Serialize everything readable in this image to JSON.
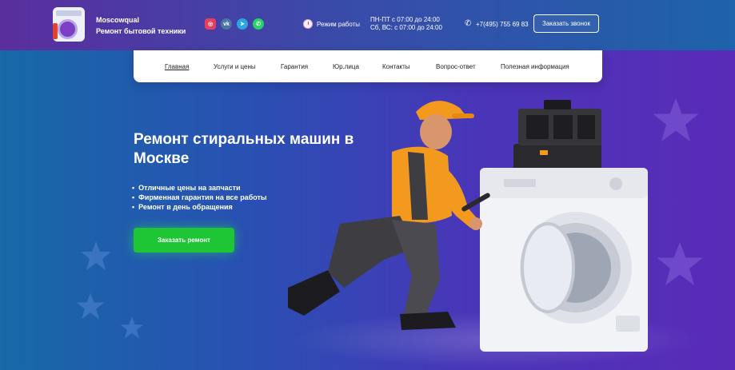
{
  "header": {
    "brand_name": "Moscowqual",
    "brand_sub": "Ремонт бытовой техники",
    "socials": [
      {
        "id": "instagram",
        "icon": "instagram-icon",
        "glyph": "◎"
      },
      {
        "id": "vk",
        "icon": "vk-icon",
        "glyph": "vk"
      },
      {
        "id": "telegram",
        "icon": "telegram-icon",
        "glyph": "➤"
      },
      {
        "id": "whatsapp",
        "icon": "whatsapp-icon",
        "glyph": "✆"
      }
    ],
    "hours_label": "Режим работы",
    "hours_weekdays": "ПН-ПТ с 07:00 до 24:00",
    "hours_weekend": "Сб, ВС: с 07:00 до 24:00",
    "phone": "+7(495) 755 69 83",
    "callback_label": "Заказать звонок"
  },
  "nav": {
    "items": [
      {
        "label": "Главная",
        "active": true
      },
      {
        "label": "Услуги и цены",
        "active": false
      },
      {
        "label": "Гарантия",
        "active": false
      },
      {
        "label": "Юр.лица",
        "active": false
      },
      {
        "label": "Контакты",
        "active": false
      },
      {
        "label": "Вопрос-ответ",
        "active": false
      },
      {
        "label": "Полезная информация",
        "active": false
      }
    ]
  },
  "hero": {
    "title": "Ремонт стиральных машин в Москве",
    "features": [
      "Отличные цены на запчасти",
      "Фирменная гарантия на все работы",
      "Ремонт в день обращения"
    ],
    "cta_label": "Заказать ремонт"
  },
  "colors": {
    "cta": "#1ec636",
    "accent_orange": "#f39a1e",
    "bg_left": "#1769a8",
    "bg_right": "#5a2bb8"
  }
}
